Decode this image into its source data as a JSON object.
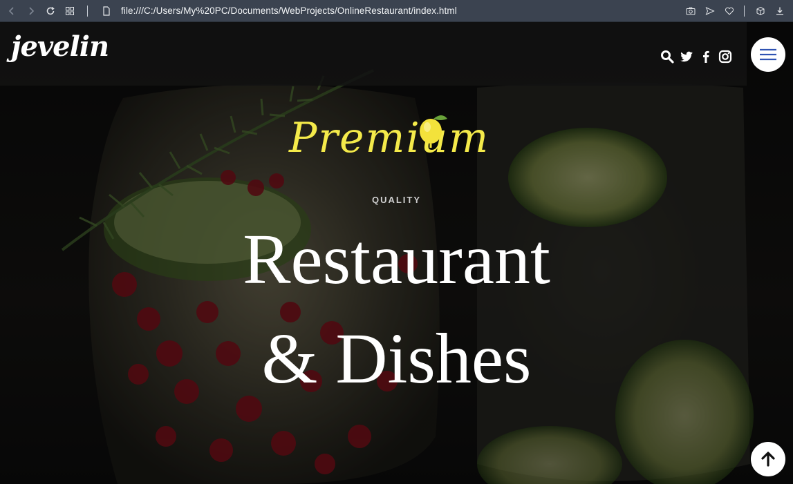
{
  "browser": {
    "url": "file:///C:/Users/My%20PC/Documents/WebProjects/OnlineRestaurant/index.html",
    "icons": [
      "back-icon",
      "forward-icon",
      "reload-icon",
      "tabs-grid-icon",
      "file-icon",
      "camera-icon",
      "send-icon",
      "heart-icon",
      "cube-icon",
      "download-icon"
    ]
  },
  "header": {
    "logo": "jevelin",
    "social": [
      "search-icon",
      "twitter-icon",
      "facebook-icon",
      "instagram-icon"
    ],
    "menu": "hamburger-menu-icon"
  },
  "hero": {
    "script_title": "Premium",
    "subtitle": "QUALITY",
    "title_line1": "Restaurant",
    "title_line2": "& Dishes"
  },
  "colors": {
    "accent_yellow": "#f4ea4a",
    "menu_blue": "#2f53b3",
    "browser_bar": "#3b4350"
  }
}
